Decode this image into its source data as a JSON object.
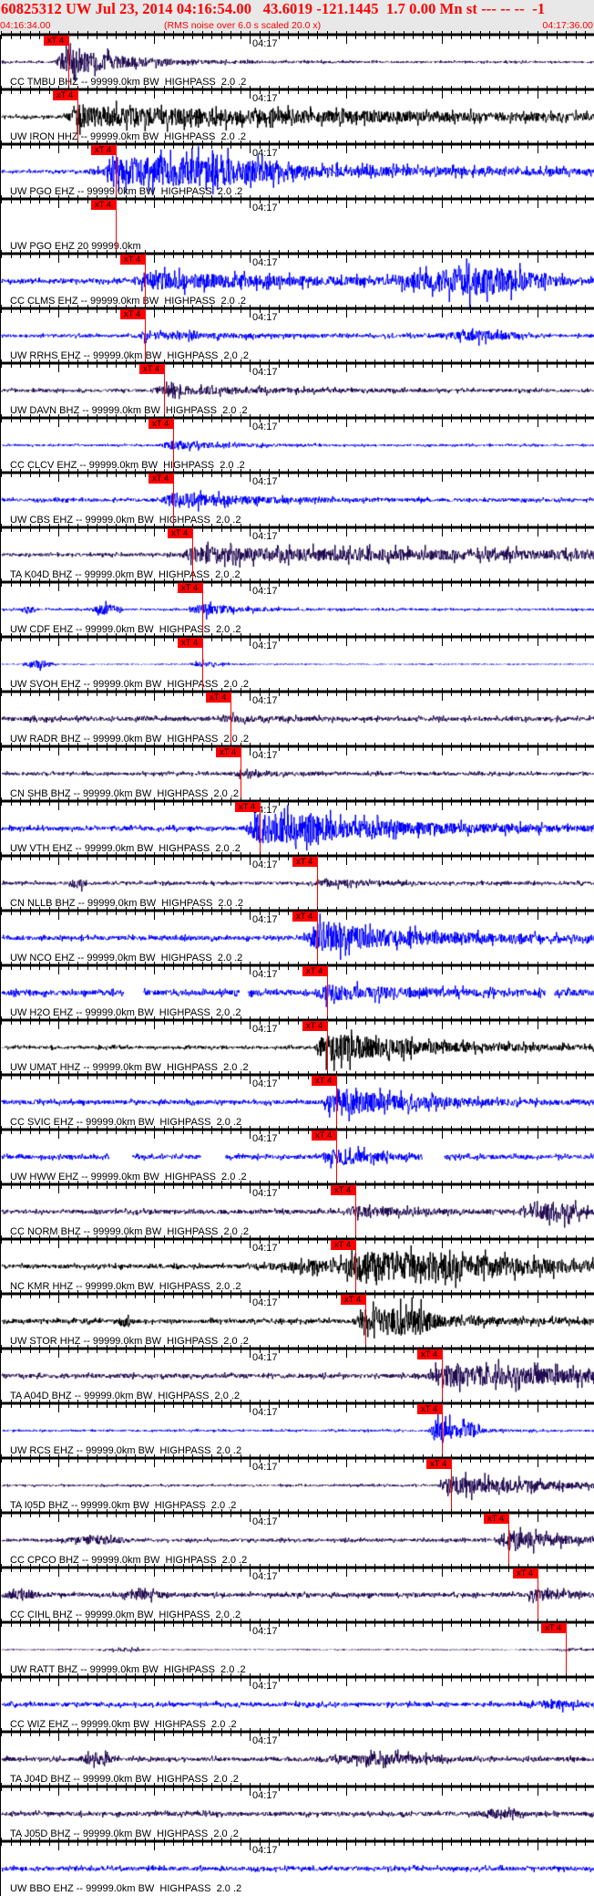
{
  "header": {
    "title": "60825312 UW Jul 23, 2014 04:16:54.00   43.6019 -121.1445  1.7 0.00 Mn st --- -- --  -1",
    "start_time": "04:16:34.00",
    "note": "(RMS noise over 6.0 s scaled 20.0 x)",
    "end_time": "04:17:36.00"
  },
  "time_axis": {
    "tick_label": "04:17",
    "duration_s": 62,
    "major_tick_offset_s": 6
  },
  "pick_label": "xT 4",
  "colors": {
    "pick": "#ff0000",
    "purple": "#200a50",
    "blue": "#0000ff",
    "black": "#000000"
  },
  "stations": [
    {
      "label": "CC TMBU BHZ -- 99999.0km BW  HIGHPASS  2.0 .2",
      "color": "purple",
      "pick_s": 7
    },
    {
      "label": "UW IRON HHZ -- 99999.0km BW  HIGHPASS  2.0 .2",
      "color": "black",
      "pick_s": 8
    },
    {
      "label": "UW PGO EHZ -- 99999.0km BW  HIGHPASS  2.0 .2",
      "color": "blue",
      "pick_s": 12
    },
    {
      "label": "UW PGO EHZ 20 99999.0km",
      "color": "blue",
      "pick_s": 12
    },
    {
      "label": "CC CLMS EHZ -- 99999.0km BW  HIGHPASS  2.0 .2",
      "color": "blue",
      "pick_s": 15
    },
    {
      "label": "UW RRHS EHZ -- 99999.0km BW  HIGHPASS  2.0 .2",
      "color": "blue",
      "pick_s": 15
    },
    {
      "label": "UW DAVN BHZ -- 99999.0km BW  HIGHPASS  2.0 .2",
      "color": "purple",
      "pick_s": 17
    },
    {
      "label": "CC CLCV EHZ -- 99999.0km BW  HIGHPASS  2.0 .2",
      "color": "blue",
      "pick_s": 18
    },
    {
      "label": "UW CBS EHZ -- 99999.0km BW  HIGHPASS  2.0 .2",
      "color": "blue",
      "pick_s": 18
    },
    {
      "label": "TA K04D BHZ -- 99999.0km BW  HIGHPASS  2.0 .2",
      "color": "purple",
      "pick_s": 20
    },
    {
      "label": "UW CDF EHZ -- 99999.0km BW  HIGHPASS  2.0 .2",
      "color": "blue",
      "pick_s": 21
    },
    {
      "label": "UW SVOH EHZ -- 99999.0km BW  HIGHPASS  2.0 .2",
      "color": "blue",
      "pick_s": 21
    },
    {
      "label": "UW RADR BHZ -- 99999.0km BW  HIGHPASS  2.0 .2",
      "color": "purple",
      "pick_s": 24
    },
    {
      "label": "CN SHB BHZ -- 99999.0km BW  HIGHPASS  2.0 .2",
      "color": "purple",
      "pick_s": 25
    },
    {
      "label": "UW VTH EHZ -- 99999.0km BW  HIGHPASS  2.0 .2",
      "color": "blue",
      "pick_s": 27
    },
    {
      "label": "CN NLLB BHZ -- 99999.0km BW  HIGHPASS  2.0 .2",
      "color": "purple",
      "pick_s": 33
    },
    {
      "label": "UW NCO EHZ -- 99999.0km BW  HIGHPASS  2.0 .2",
      "color": "blue",
      "pick_s": 33
    },
    {
      "label": "UW H2O EHZ -- 99999.0km BW  HIGHPASS  2.0 .2",
      "color": "blue",
      "pick_s": 34,
      "gaps_s": [
        [
          12.8,
          14.9
        ],
        [
          24.9,
          25.8
        ],
        [
          56.8,
          57.8
        ]
      ]
    },
    {
      "label": "UW UMAT HHZ -- 99999.0km BW  HIGHPASS  2.0 .2",
      "color": "black",
      "pick_s": 34
    },
    {
      "label": "CC SVIC EHZ -- 99999.0km BW  HIGHPASS  2.0 .2",
      "color": "blue",
      "pick_s": 35
    },
    {
      "label": "UW HWW EHZ -- 99999.0km BW  HIGHPASS  2.0 .2",
      "color": "blue",
      "pick_s": 35,
      "gaps_s": [
        [
          11.3,
          13.7
        ],
        [
          20.9,
          23.4
        ],
        [
          44.0,
          46.3
        ]
      ]
    },
    {
      "label": "CC NORM BHZ -- 99999.0km BW  HIGHPASS  2.0 .2",
      "color": "purple",
      "pick_s": 37
    },
    {
      "label": "NC KMR HHZ -- 99999.0km BW  HIGHPASS  2.0 .2",
      "color": "black",
      "pick_s": 37
    },
    {
      "label": "UW STOR HHZ -- 99999.0km BW  HIGHPASS  2.0 .2",
      "color": "black",
      "pick_s": 38
    },
    {
      "label": "TA A04D BHZ -- 99999.0km BW  HIGHPASS  2.0 .2",
      "color": "purple",
      "pick_s": 46
    },
    {
      "label": "UW RCS EHZ -- 99999.0km BW  HIGHPASS  2.0 .2",
      "color": "blue",
      "pick_s": 46
    },
    {
      "label": "TA I05D BHZ -- 99999.0km BW  HIGHPASS  2.0 .2",
      "color": "purple",
      "pick_s": 47
    },
    {
      "label": "CC CPCO BHZ -- 99999.0km BW  HIGHPASS  2.0 .2",
      "color": "purple",
      "pick_s": 53
    },
    {
      "label": "CC CIHL BHZ -- 99999.0km BW  HIGHPASS  2.0 .2",
      "color": "purple",
      "pick_s": 56
    },
    {
      "label": "UW RATT BHZ -- 99999.0km BW  HIGHPASS  2.0 .2",
      "color": "purple",
      "pick_s": 59
    },
    {
      "label": "CC WIZ EHZ -- 99999.0km BW  HIGHPASS  2.0 .2",
      "color": "blue",
      "pick_s": null
    },
    {
      "label": "TA J04D BHZ -- 99999.0km BW  HIGHPASS  2.0 .2",
      "color": "purple",
      "pick_s": null
    },
    {
      "label": "TA J05D BHZ -- 99999.0km BW  HIGHPASS  2.0 .2",
      "color": "purple",
      "pick_s": null
    },
    {
      "label": "UW BBO EHZ -- 99999.0km BW  HIGHPASS  2.0 .2",
      "color": "blue",
      "pick_s": null
    }
  ]
}
